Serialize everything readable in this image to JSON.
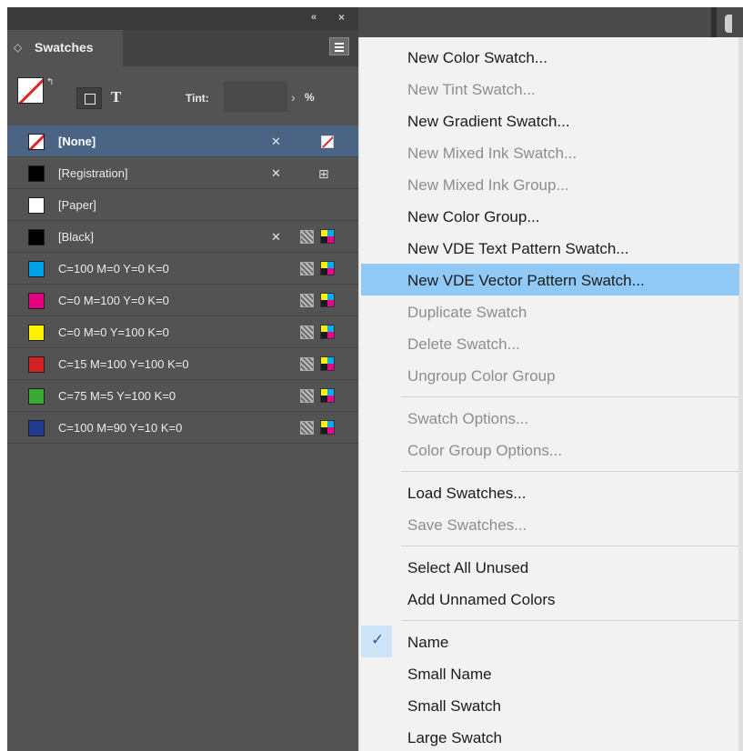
{
  "panel": {
    "title": "Swatches",
    "collapse_icon": "«",
    "close_icon": "×",
    "tint_label": "Tint:",
    "tint_value": "",
    "tint_unit": "%",
    "text_button": "T"
  },
  "swatches": [
    {
      "name": "[None]",
      "color": "none",
      "selected": true,
      "icons": [
        "nonedit",
        "none"
      ]
    },
    {
      "name": "[Registration]",
      "color": "#000000",
      "icons": [
        "nonedit",
        "registration"
      ]
    },
    {
      "name": "[Paper]",
      "color": "#ffffff",
      "icons": []
    },
    {
      "name": "[Black]",
      "color": "#000000",
      "icons": [
        "nonedit",
        "process",
        "cmyk"
      ]
    },
    {
      "name": "C=100 M=0 Y=0 K=0",
      "color": "#00a0e6",
      "icons": [
        "process",
        "cmyk"
      ]
    },
    {
      "name": "C=0 M=100 Y=0 K=0",
      "color": "#e4007f",
      "icons": [
        "process",
        "cmyk"
      ]
    },
    {
      "name": "C=0 M=0 Y=100 K=0",
      "color": "#fff100",
      "icons": [
        "process",
        "cmyk"
      ]
    },
    {
      "name": "C=15 M=100 Y=100 K=0",
      "color": "#d22228",
      "icons": [
        "process",
        "cmyk"
      ]
    },
    {
      "name": "C=75 M=5 Y=100 K=0",
      "color": "#3aa935",
      "icons": [
        "process",
        "cmyk"
      ]
    },
    {
      "name": "C=100 M=90 Y=10 K=0",
      "color": "#233a8e",
      "icons": [
        "process",
        "cmyk"
      ]
    }
  ],
  "menu": {
    "items": [
      {
        "label": "New Color Swatch...",
        "enabled": true
      },
      {
        "label": "New Tint Swatch...",
        "enabled": false
      },
      {
        "label": "New Gradient Swatch...",
        "enabled": true
      },
      {
        "label": "New Mixed Ink Swatch...",
        "enabled": false
      },
      {
        "label": "New Mixed Ink Group...",
        "enabled": false
      },
      {
        "label": "New Color Group...",
        "enabled": true
      },
      {
        "label": "New VDE Text Pattern Swatch...",
        "enabled": true
      },
      {
        "label": "New VDE Vector Pattern Swatch...",
        "enabled": true,
        "highlighted": true
      },
      {
        "label": "Duplicate Swatch",
        "enabled": false
      },
      {
        "label": "Delete Swatch...",
        "enabled": false
      },
      {
        "label": "Ungroup Color Group",
        "enabled": false
      },
      {
        "separator": true
      },
      {
        "label": "Swatch Options...",
        "enabled": false
      },
      {
        "label": "Color Group Options...",
        "enabled": false
      },
      {
        "separator": true
      },
      {
        "label": "Load Swatches...",
        "enabled": true
      },
      {
        "label": "Save Swatches...",
        "enabled": false
      },
      {
        "separator": true
      },
      {
        "label": "Select All Unused",
        "enabled": true
      },
      {
        "label": "Add Unnamed Colors",
        "enabled": true
      },
      {
        "separator": true
      },
      {
        "label": "Name",
        "enabled": true,
        "checked": true
      },
      {
        "label": "Small Name",
        "enabled": true
      },
      {
        "label": "Small Swatch",
        "enabled": true
      },
      {
        "label": "Large Swatch",
        "enabled": true
      }
    ]
  },
  "colors": {
    "panel_bg": "#535353",
    "selected_row": "#4b6484",
    "menu_bg": "#f2f2f2",
    "menu_highlight": "#90c8f6"
  }
}
